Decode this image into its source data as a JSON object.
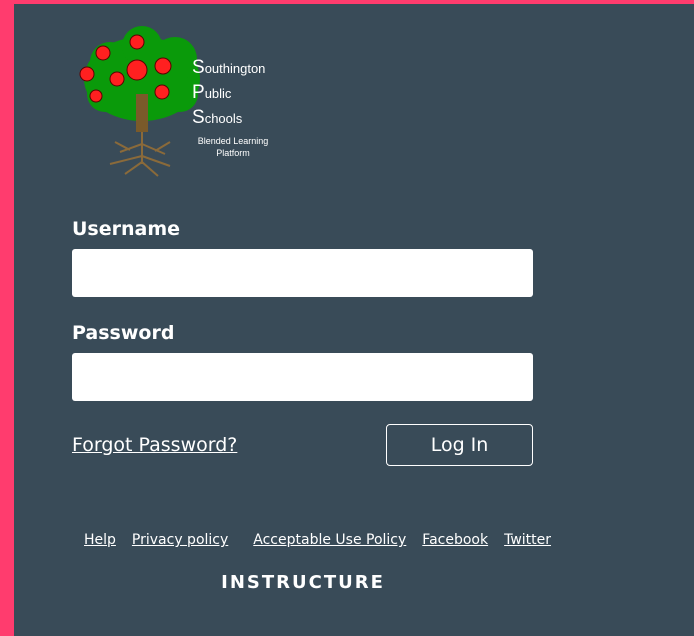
{
  "logo": {
    "line1_cap": "S",
    "line1_rest": "outhington",
    "line2_cap": "P",
    "line2_rest": "ublic",
    "line3_cap": "S",
    "line3_rest": "chools",
    "sub": "Blended Learning Platform",
    "icon": "apple-tree-icon"
  },
  "form": {
    "username_label": "Username",
    "username_value": "",
    "password_label": "Password",
    "password_value": "",
    "forgot_label": "Forgot Password?",
    "login_label": "Log In"
  },
  "footer": {
    "links": [
      "Help",
      "Privacy policy",
      "Acceptable Use Policy",
      "Facebook",
      "Twitter"
    ],
    "brand": "INSTRUCTURE"
  },
  "colors": {
    "frame": "#ff3c6e",
    "panel": "#394b58",
    "tree_leaves": "#0a9a0a",
    "apples": "#ff2020",
    "trunk": "#7a5a2a"
  }
}
